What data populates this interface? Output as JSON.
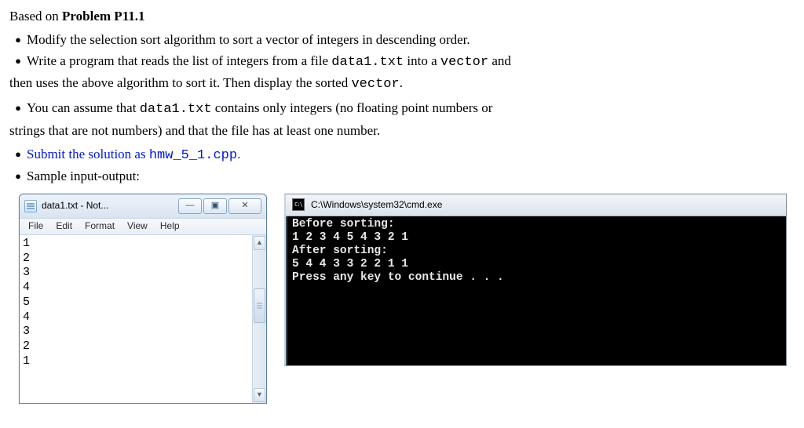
{
  "heading_prefix": "Based on ",
  "heading_bold": "Problem P11.1",
  "bullets": {
    "b1": "Modify the selection sort algorithm to sort a vector of integers in descending order.",
    "b2a": "Write a program that reads the list of integers from a file ",
    "b2_code1": "data1.txt",
    "b2b": " into a ",
    "b2_code2": "vector",
    "b2c": " and",
    "b2_cont": "then uses the above algorithm to sort it.  Then display the sorted ",
    "b2_code3": "vector",
    "b2_end": ".",
    "b3a": "You can assume that ",
    "b3_code1": "data1.txt",
    "b3b": " contains only integers (no floating point numbers or",
    "b3_cont": "strings that are not numbers) and that the file has at least one number.",
    "b4a": "Submit the solution as ",
    "b4_code": "hmw_5_1.cpp",
    "b4b": ".",
    "b5": "Sample input-output:"
  },
  "notepad": {
    "title": "data1.txt - Not...",
    "menus": [
      "File",
      "Edit",
      "Format",
      "View",
      "Help"
    ],
    "content": "1\n2\n3\n4\n5\n4\n3\n2\n1"
  },
  "cmd": {
    "title": "C:\\Windows\\system32\\cmd.exe",
    "icon": "C:\\",
    "lines": "Before sorting:\n1 2 3 4 5 4 3 2 1\nAfter sorting:\n5 4 4 3 3 2 2 1 1\nPress any key to continue . . ."
  }
}
